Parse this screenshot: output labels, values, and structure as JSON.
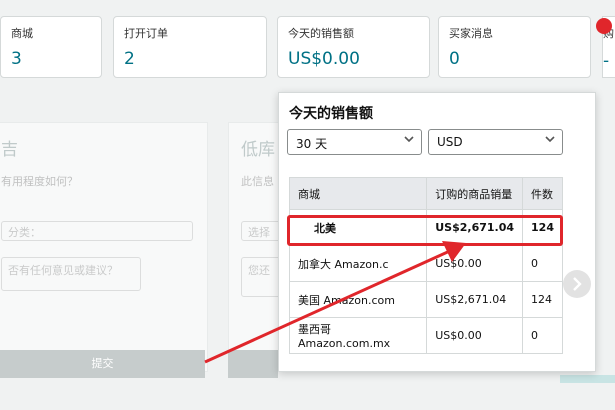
{
  "stats": [
    {
      "label": "商城",
      "value": "3"
    },
    {
      "label": "打开订单",
      "value": "2"
    },
    {
      "label": "今天的销售额",
      "value": "US$0.00"
    },
    {
      "label": "买家消息",
      "value": "0"
    }
  ],
  "right_col": {
    "label": "购",
    "value": "--"
  },
  "background": {
    "left": {
      "title": "吉",
      "question": "有用程度如何？",
      "select_placeholder": "分类：",
      "textarea_placeholder": "否有任何意见或建议？",
      "submit_label": "提交"
    },
    "right": {
      "title": "低库",
      "info": "此信息",
      "select_placeholder": "选择",
      "textarea_placeholder": "您还"
    }
  },
  "sales_panel": {
    "title": "今天的销售额",
    "period_select": "30 天",
    "currency_select": "USD",
    "table": {
      "headers": [
        "商城",
        "订购的商品销量",
        "件数"
      ],
      "rows": [
        {
          "market": "北美",
          "sales": "US$2,671.04",
          "units": "124"
        },
        {
          "market": "加拿大 Amazon.c",
          "sales": "US$0.00",
          "units": "0"
        },
        {
          "market": "美国 Amazon.com",
          "sales": "US$2,671.04",
          "units": "124"
        },
        {
          "market": "墨西哥 Amazon.com.mx",
          "sales": "US$0.00",
          "units": "0"
        }
      ]
    }
  },
  "colors": {
    "accent": "#007185",
    "highlight": "#e0262b"
  }
}
